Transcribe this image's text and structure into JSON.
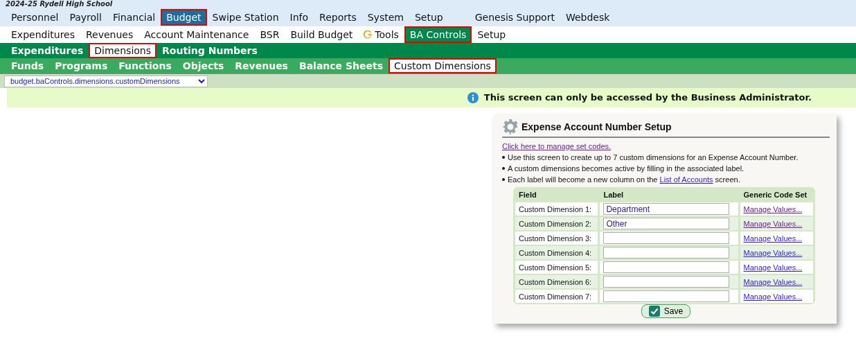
{
  "school_title": "2024-25 Rydell High School",
  "main_menu": {
    "items": [
      {
        "label": "Personnel",
        "selected": false
      },
      {
        "label": "Payroll",
        "selected": false
      },
      {
        "label": "Financial",
        "selected": false
      },
      {
        "label": "Budget",
        "selected": true
      },
      {
        "label": "Swipe Station",
        "selected": false
      },
      {
        "label": "Info",
        "selected": false
      },
      {
        "label": "Reports",
        "selected": false
      },
      {
        "label": "System",
        "selected": false
      },
      {
        "label": "Setup",
        "selected": false
      }
    ],
    "extra_items": [
      {
        "label": "Genesis Support"
      },
      {
        "label": "Webdesk"
      }
    ]
  },
  "sub_menu": [
    {
      "label": "Expenditures",
      "selected": false
    },
    {
      "label": "Revenues",
      "selected": false
    },
    {
      "label": "Account Maintenance",
      "selected": false
    },
    {
      "label": "BSR",
      "selected": false
    },
    {
      "label": "Build Budget",
      "selected": false
    },
    {
      "label": "Tools",
      "selected": false,
      "kind": "tools"
    },
    {
      "label": "BA Controls",
      "selected": true
    },
    {
      "label": "Setup",
      "selected": false
    }
  ],
  "third_menu": [
    {
      "label": "Expenditures",
      "selected": false
    },
    {
      "label": "Dimensions",
      "selected": true
    },
    {
      "label": "Routing Numbers",
      "selected": false
    }
  ],
  "fourth_menu": [
    {
      "label": "Funds",
      "selected": false
    },
    {
      "label": "Programs",
      "selected": false
    },
    {
      "label": "Functions",
      "selected": false
    },
    {
      "label": "Objects",
      "selected": false
    },
    {
      "label": "Revenues",
      "selected": false
    },
    {
      "label": "Balance Sheets",
      "selected": false
    },
    {
      "label": "Custom Dimensions",
      "selected": true
    }
  ],
  "screen_select": {
    "value": "budget.baControls.dimensions.customDimensions"
  },
  "notice": "This screen can only be accessed by the Business Administrator.",
  "panel": {
    "title": "Expense Account Number Setup",
    "link": "Click here to manage set codes.",
    "bullets": [
      "Use this screen to create up to 7 custom dimensions for an Expense Account Number.",
      "A custom dimensions becomes active by filling in the associated label.",
      {
        "before": "Each label will become a new column on the ",
        "link": "List of Accounts",
        "after": " screen."
      }
    ],
    "columns": [
      "Field",
      "Label",
      "Generic Code Set"
    ],
    "rows": [
      {
        "field": "Custom Dimension 1:",
        "label": "Department",
        "action": "Manage Values...",
        "visited": true
      },
      {
        "field": "Custom Dimension 2:",
        "label": "Other",
        "action": "Manage Values...",
        "visited": true
      },
      {
        "field": "Custom Dimension 3:",
        "action": "Manage Values...",
        "visited": false
      },
      {
        "field": "Custom Dimension 4:",
        "action": "Manage Values...",
        "visited": false
      },
      {
        "field": "Custom Dimension 5:",
        "action": "Manage Values...",
        "visited": false
      },
      {
        "field": "Custom Dimension 6:",
        "action": "Manage Values...",
        "visited": false
      },
      {
        "field": "Custom Dimension 7:",
        "action": "Manage Values...",
        "visited": false
      }
    ],
    "save_button": "Save"
  }
}
